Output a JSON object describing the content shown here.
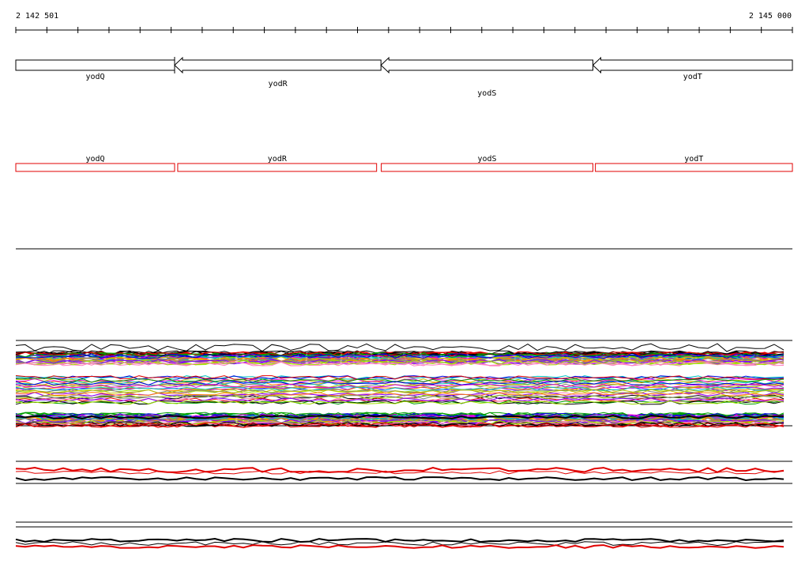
{
  "ruler": {
    "start_label": "2 142 501",
    "end_label": "2 145 000",
    "start": 2142501,
    "end": 2145000
  },
  "genes": [
    {
      "name": "yodQ",
      "start": 2142501,
      "end": 2143012,
      "strand": "-"
    },
    {
      "name": "yodR",
      "start": 2143012,
      "end": 2143676,
      "strand": "-"
    },
    {
      "name": "yodS",
      "start": 2143676,
      "end": 2144358,
      "strand": "-"
    },
    {
      "name": "yodT",
      "start": 2144358,
      "end": 2145000,
      "strand": "-"
    }
  ],
  "annotations": [
    {
      "name": "yodQ",
      "start": 2142501,
      "end": 2143012
    },
    {
      "name": "yodR",
      "start": 2143022,
      "end": 2143662
    },
    {
      "name": "yodS",
      "start": 2143677,
      "end": 2144358
    },
    {
      "name": "yodT",
      "start": 2144366,
      "end": 2145000
    }
  ],
  "colors": {
    "gene_stroke": "#000000",
    "annotation_stroke": "#e00000",
    "track_separator": "#000000"
  },
  "profile_palette": [
    "#000000",
    "#e00000",
    "#00a000",
    "#0000e0",
    "#e000e0",
    "#00c0c0",
    "#c0c000",
    "#ff8000",
    "#808080",
    "#8000ff",
    "#a0e000",
    "#ff80c0"
  ]
}
